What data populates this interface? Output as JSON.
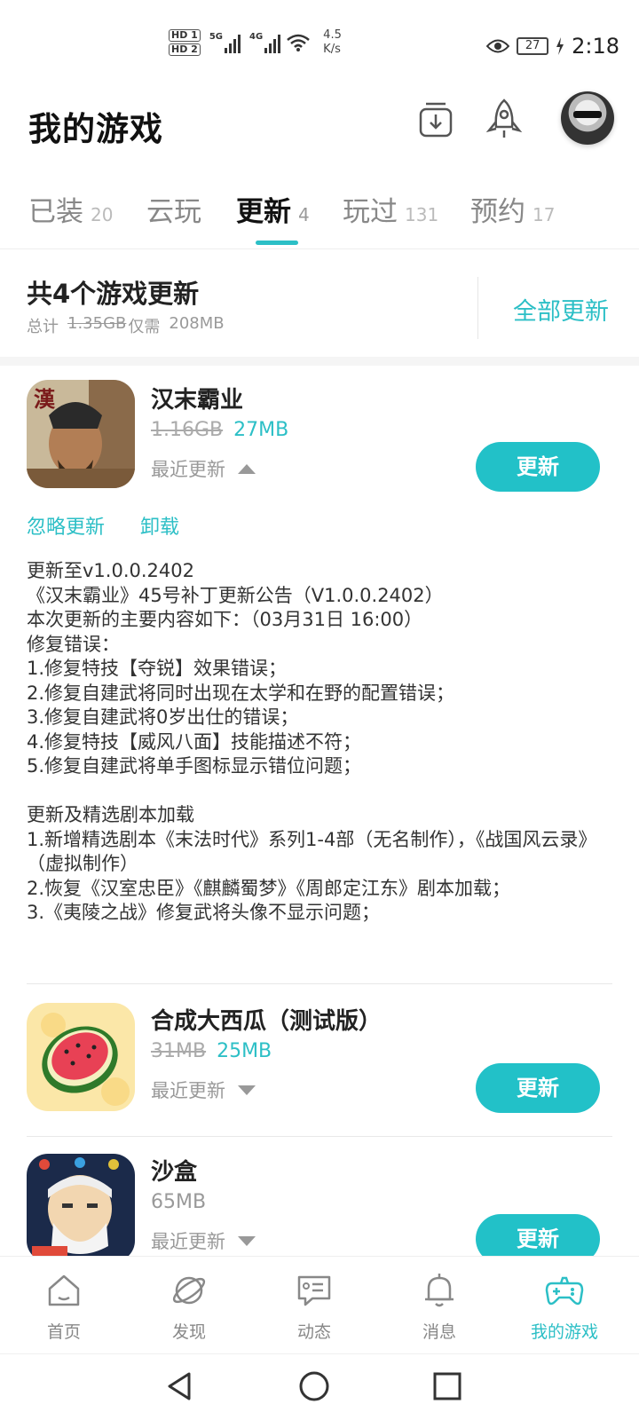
{
  "status_bar": {
    "hd1": "HD 1",
    "hd2": "HD 2",
    "net1": "5G",
    "net2": "4G",
    "speed_value": "4.5",
    "speed_unit": "K/s",
    "battery": "27",
    "time": "2:18"
  },
  "header": {
    "title": "我的游戏",
    "icons": [
      "download-manager-icon",
      "rocket-icon",
      "avatar"
    ]
  },
  "tabs": [
    {
      "label": "已装",
      "count": "20"
    },
    {
      "label": "云玩",
      "count": ""
    },
    {
      "label": "更新",
      "count": "4",
      "active": true
    },
    {
      "label": "玩过",
      "count": "131"
    },
    {
      "label": "预约",
      "count": "17"
    }
  ],
  "summary": {
    "title": "共4个游戏更新",
    "total_prefix": "总计",
    "total_old": "1.35GB",
    "total_only": "仅需",
    "total_new": "208MB",
    "update_all": "全部更新"
  },
  "games": [
    {
      "name": "汉末霸业",
      "old_size": "1.16GB",
      "new_size": "27MB",
      "recent": "最近更新",
      "expanded": true,
      "button": "更新",
      "ignore": "忽略更新",
      "uninstall": "卸载",
      "notes": "更新至v1.0.0.2402\n《汉末霸业》45号补丁更新公告（V1.0.0.2402）\n本次更新的主要内容如下：（03月31日 16:00）\n修复错误：\n1.修复特技【夺锐】效果错误；\n2.修复自建武将同时出现在太学和在野的配置错误；\n3.修复自建武将0岁出仕的错误；\n4.修复特技【威风八面】技能描述不符；\n5.修复自建武将单手图标显示错位问题；\n\n更新及精选剧本加载\n1.新增精选剧本《末法时代》系列1-4部（无名制作），《战国风云录》（虚拟制作）\n2.恢复《汉室忠臣》《麒麟蜀梦》《周郎定江东》剧本加载；\n3.《夷陵之战》修复武将头像不显示问题；"
    },
    {
      "name": "合成大西瓜（测试版）",
      "old_size": "31MB",
      "new_size": "25MB",
      "recent": "最近更新",
      "expanded": false,
      "button": "更新"
    },
    {
      "name": "沙盒",
      "size": "65MB",
      "recent": "最近更新",
      "expanded": false,
      "button": "更新"
    }
  ],
  "bottom_nav": [
    {
      "label": "首页",
      "icon": "home-icon"
    },
    {
      "label": "发现",
      "icon": "discover-icon"
    },
    {
      "label": "动态",
      "icon": "feed-icon"
    },
    {
      "label": "消息",
      "icon": "bell-icon"
    },
    {
      "label": "我的游戏",
      "icon": "gamepad-icon",
      "active": true
    }
  ],
  "colors": {
    "accent": "#22c1c8",
    "text": "#222222",
    "muted": "#999999"
  }
}
